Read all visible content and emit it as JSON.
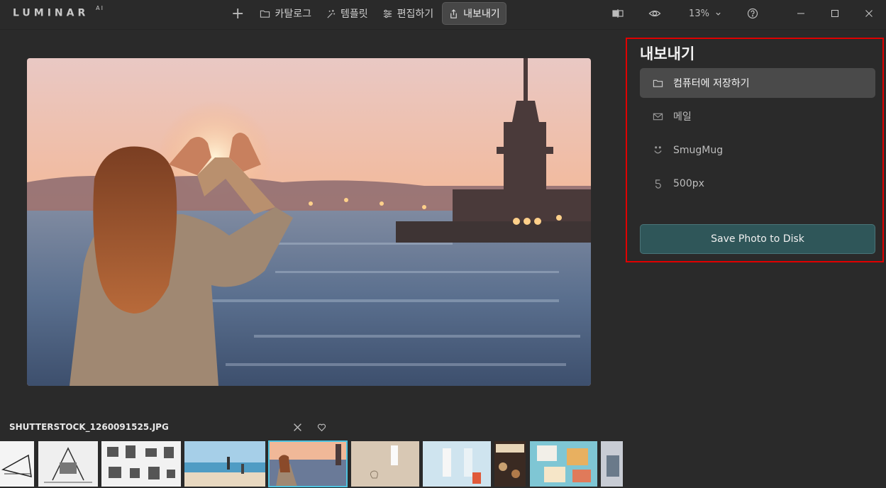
{
  "app": {
    "logo": "LUMINAR",
    "logo_suffix": "AI"
  },
  "nav": {
    "add": "+",
    "catalog": "카탈로그",
    "templates": "템플릿",
    "edit": "편집하기",
    "export": "내보내기"
  },
  "tools": {
    "zoom": "13%"
  },
  "export_panel": {
    "title": "내보내기",
    "options": [
      {
        "label": "컴퓨터에 저장하기",
        "icon": "folder-icon",
        "selected": true
      },
      {
        "label": "메일",
        "icon": "mail-icon",
        "selected": false
      },
      {
        "label": "SmugMug",
        "icon": "smugmug-icon",
        "selected": false
      },
      {
        "label": "500px",
        "icon": "500px-icon",
        "selected": false
      }
    ],
    "save_button": "Save Photo to Disk"
  },
  "filmstrip": {
    "filename": "SHUTTERSTOCK_1260091525.JPG",
    "selected_index": 5
  },
  "colors": {
    "background": "#2a2a2a",
    "accent_save": "#2f5659",
    "selection_outline": "#4ec3e0",
    "highlight_box": "#e00000"
  }
}
